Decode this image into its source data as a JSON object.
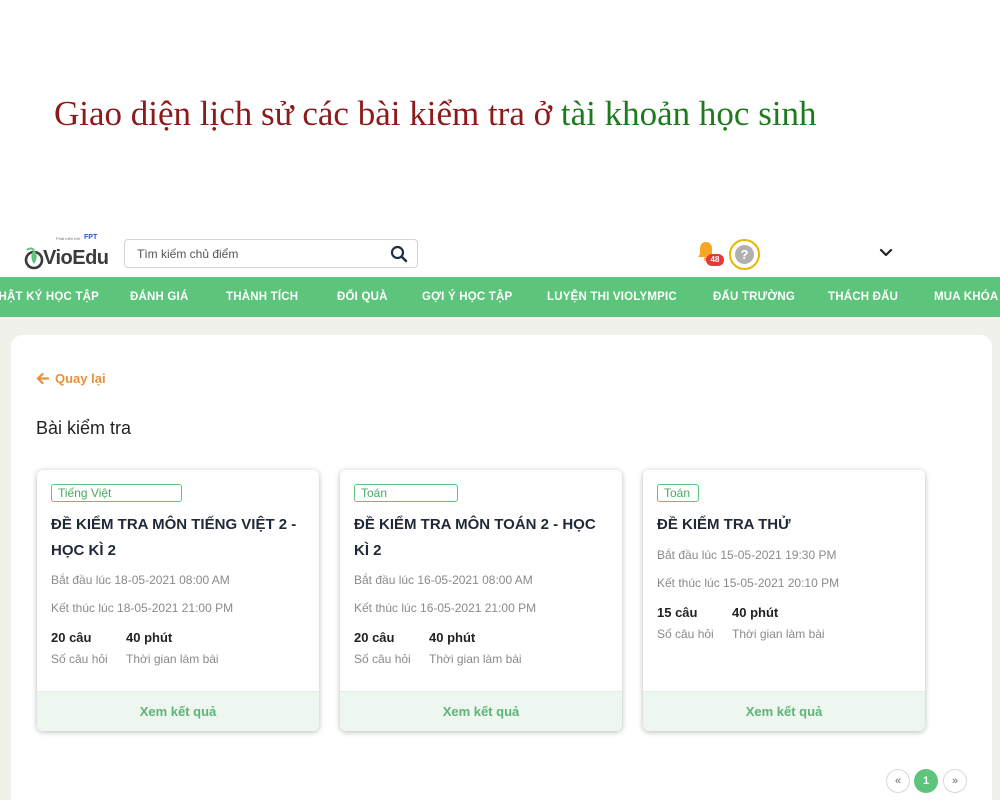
{
  "caption": {
    "part1": "Giao diện lịch sử các bài kiểm tra ở ",
    "part2": "tài khoản học sinh"
  },
  "header": {
    "logo_subtext": "Phát triển bởi",
    "logo_fpt": "FPT",
    "brand": "VioEdu",
    "search_placeholder": "Tìm kiếm chủ điểm",
    "notification_count": "48",
    "avatar_glyph": "?"
  },
  "nav": {
    "items": [
      "NHẬT KÝ HỌC TẬP",
      "ĐÁNH GIÁ",
      "THÀNH TÍCH",
      "ĐỔI QUÀ",
      "GỢI Ý HỌC TẬP",
      "LUYỆN THI VIOLYMPIC",
      "ĐẤU TRƯỜNG",
      "THÁCH ĐẤU",
      "MUA KHÓA"
    ]
  },
  "main": {
    "back_label": "Quay lại",
    "section_title": "Bài kiểm tra",
    "cards": [
      {
        "subject": "Tiếng Việt",
        "title": "ĐỀ KIỂM TRA MÔN TIẾNG VIỆT 2 - HỌC KÌ 2",
        "start": "Bắt đầu lúc 18-05-2021 08:00 AM",
        "end": "Kết thúc lúc 18-05-2021 21:00 PM",
        "questions_value": "20 câu",
        "questions_label": "Số câu hỏi",
        "duration_value": "40 phút",
        "duration_label": "Thời gian làm bài",
        "action": "Xem kết quả"
      },
      {
        "subject": "Toán",
        "title": "ĐỀ KIỂM TRA MÔN TOÁN 2 - HỌC KÌ 2",
        "start": "Bắt đầu lúc 16-05-2021 08:00 AM",
        "end": "Kết thúc lúc 16-05-2021 21:00 PM",
        "questions_value": "20 câu",
        "questions_label": "Số câu hỏi",
        "duration_value": "40 phút",
        "duration_label": "Thời gian làm bài",
        "action": "Xem kết quả"
      },
      {
        "subject": "Toán",
        "title": "ĐỀ KIỂM TRA THỬ",
        "start": "Bắt đầu lúc 15-05-2021 19:30 PM",
        "end": "Kết thúc lúc 15-05-2021 20:10 PM",
        "questions_value": "15 câu",
        "questions_label": "Số câu hỏi",
        "duration_value": "40 phút",
        "duration_label": "Thời gian làm bài",
        "action": "Xem kết quả"
      }
    ]
  },
  "pagination": {
    "prev": "«",
    "current": "1",
    "next": "»"
  },
  "colors": {
    "brand_green": "#5cc47b",
    "accent_orange": "#e8913a",
    "caption_red": "#8b1a1a",
    "caption_green": "#1e7a1e",
    "badge_red": "#e53935"
  }
}
